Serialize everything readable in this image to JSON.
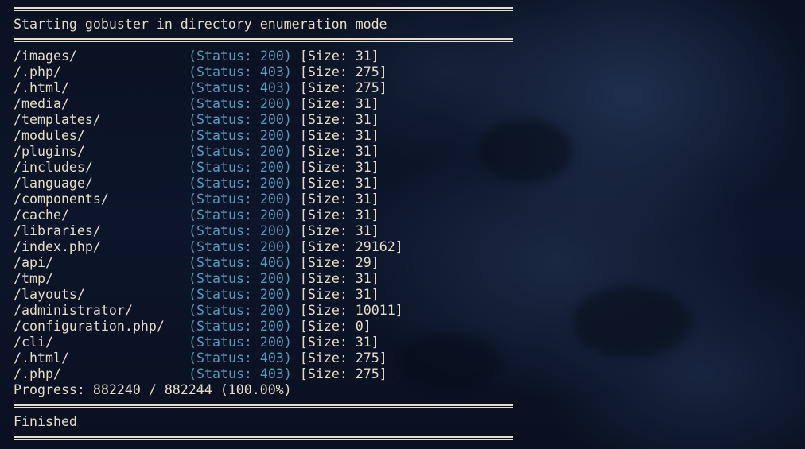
{
  "terminal": {
    "header": "Starting gobuster in directory enumeration mode",
    "results": [
      {
        "path": "/images/",
        "status": "(Status: 200)",
        "size": "[Size: 31]"
      },
      {
        "path": "/.php/",
        "status": "(Status: 403)",
        "size": "[Size: 275]"
      },
      {
        "path": "/.html/",
        "status": "(Status: 403)",
        "size": "[Size: 275]"
      },
      {
        "path": "/media/",
        "status": "(Status: 200)",
        "size": "[Size: 31]"
      },
      {
        "path": "/templates/",
        "status": "(Status: 200)",
        "size": "[Size: 31]"
      },
      {
        "path": "/modules/",
        "status": "(Status: 200)",
        "size": "[Size: 31]"
      },
      {
        "path": "/plugins/",
        "status": "(Status: 200)",
        "size": "[Size: 31]"
      },
      {
        "path": "/includes/",
        "status": "(Status: 200)",
        "size": "[Size: 31]"
      },
      {
        "path": "/language/",
        "status": "(Status: 200)",
        "size": "[Size: 31]"
      },
      {
        "path": "/components/",
        "status": "(Status: 200)",
        "size": "[Size: 31]"
      },
      {
        "path": "/cache/",
        "status": "(Status: 200)",
        "size": "[Size: 31]"
      },
      {
        "path": "/libraries/",
        "status": "(Status: 200)",
        "size": "[Size: 31]"
      },
      {
        "path": "/index.php/",
        "status": "(Status: 200)",
        "size": "[Size: 29162]"
      },
      {
        "path": "/api/",
        "status": "(Status: 406)",
        "size": "[Size: 29]"
      },
      {
        "path": "/tmp/",
        "status": "(Status: 200)",
        "size": "[Size: 31]"
      },
      {
        "path": "/layouts/",
        "status": "(Status: 200)",
        "size": "[Size: 31]"
      },
      {
        "path": "/administrator/",
        "status": "(Status: 200)",
        "size": "[Size: 10011]"
      },
      {
        "path": "/configuration.php/",
        "status": "(Status: 200)",
        "size": "[Size: 0]"
      },
      {
        "path": "/cli/",
        "status": "(Status: 200)",
        "size": "[Size: 31]"
      },
      {
        "path": "/.html/",
        "status": "(Status: 403)",
        "size": "[Size: 275]"
      },
      {
        "path": "/.php/",
        "status": "(Status: 403)",
        "size": "[Size: 275]"
      }
    ],
    "progress": "Progress: 882240 / 882244 (100.00%)",
    "footer": "Finished"
  },
  "colors": {
    "background": "#0b1224",
    "text": "#e6dcc8",
    "status": "#4f9fbf"
  }
}
